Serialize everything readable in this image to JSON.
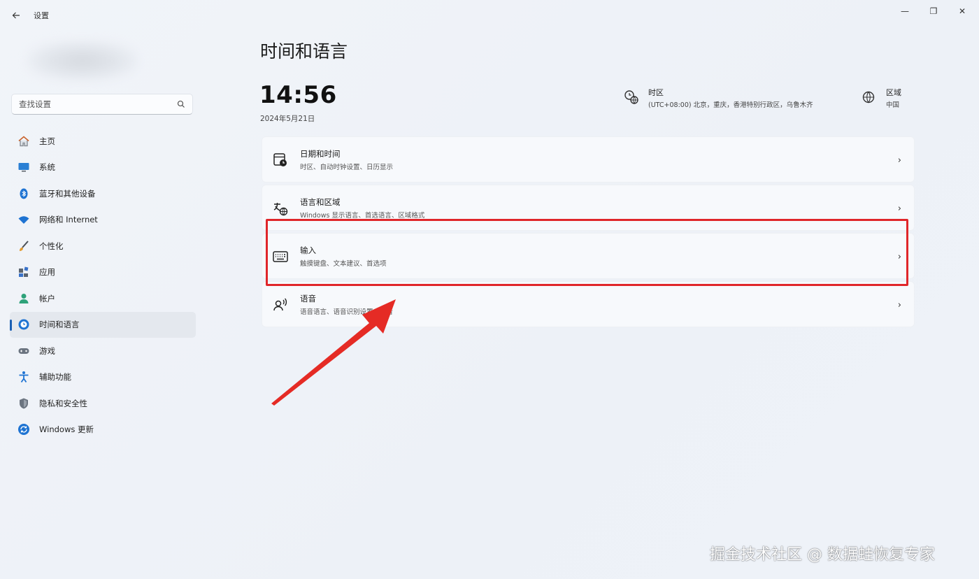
{
  "window": {
    "title": "设置",
    "controls": {
      "minimize": "—",
      "maximize": "❐",
      "close": "✕"
    }
  },
  "sidebar": {
    "search": {
      "placeholder": "查找设置"
    },
    "items": [
      {
        "label": "主页",
        "icon": "home-icon"
      },
      {
        "label": "系统",
        "icon": "system-icon"
      },
      {
        "label": "蓝牙和其他设备",
        "icon": "bluetooth-icon"
      },
      {
        "label": "网络和 Internet",
        "icon": "wifi-icon"
      },
      {
        "label": "个性化",
        "icon": "brush-icon"
      },
      {
        "label": "应用",
        "icon": "apps-icon"
      },
      {
        "label": "帐户",
        "icon": "account-icon"
      },
      {
        "label": "时间和语言",
        "icon": "time-language-icon",
        "active": true
      },
      {
        "label": "游戏",
        "icon": "gaming-icon"
      },
      {
        "label": "辅助功能",
        "icon": "accessibility-icon"
      },
      {
        "label": "隐私和安全性",
        "icon": "shield-icon"
      },
      {
        "label": "Windows 更新",
        "icon": "update-icon"
      }
    ]
  },
  "main": {
    "title": "时间和语言",
    "clock": {
      "time": "14:56",
      "date": "2024年5月21日"
    },
    "timezone": {
      "title": "时区",
      "value": "(UTC+08:00) 北京，重庆，香港特别行政区，乌鲁木齐",
      "icon": "timezone-icon"
    },
    "region": {
      "title": "区域",
      "value": "中国",
      "icon": "globe-icon"
    },
    "cards": [
      {
        "title": "日期和时间",
        "subtitle": "时区、自动时钟设置、日历显示",
        "icon": "calendar-clock-icon"
      },
      {
        "title": "语言和区域",
        "subtitle": "Windows 显示语言、首选语言、区域格式",
        "icon": "language-region-icon"
      },
      {
        "title": "输入",
        "subtitle": "触摸键盘、文本建议、首选项",
        "icon": "keyboard-icon",
        "highlighted": true
      },
      {
        "title": "语音",
        "subtitle": "语音语言、语音识别设置、声音",
        "icon": "speech-icon"
      }
    ],
    "chevron": "›"
  },
  "annotation": {
    "color": "#e0262a"
  },
  "watermark": "掘金技术社区 @ 数据蛙恢复专家",
  "colors": {
    "accent": "#1a5fb4",
    "background": "#eef2f8",
    "card": "#f7f9fc",
    "highlight": "#e0262a"
  }
}
